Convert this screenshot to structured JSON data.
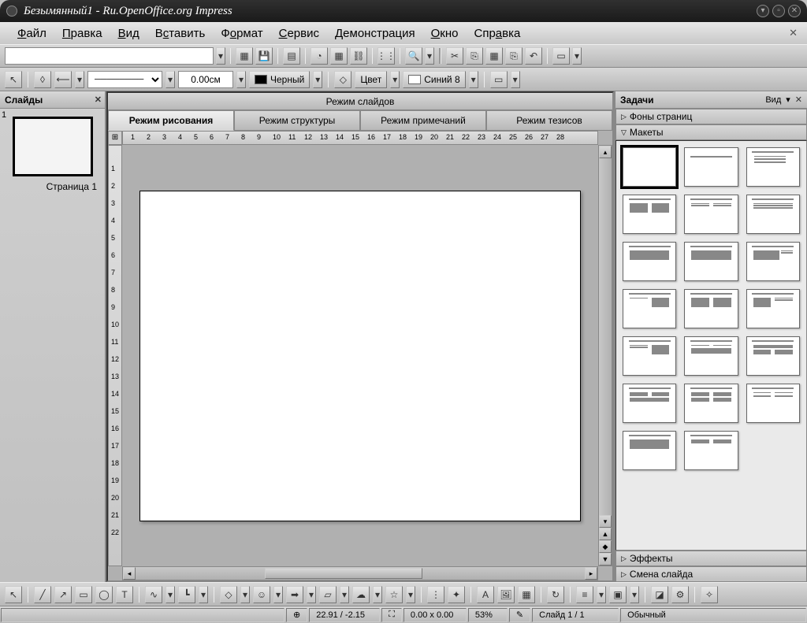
{
  "titlebar": {
    "text": "Безымянный1 - Ru.OpenOffice.org Impress"
  },
  "menu": {
    "file": "Файл",
    "edit": "Правка",
    "view": "Вид",
    "insert": "Вставить",
    "format": "Формат",
    "service": "Сервис",
    "demo": "Демонстрация",
    "window": "Окно",
    "help": "Справка"
  },
  "toolbar": {
    "url_value": "",
    "line_width": "0.00см",
    "color_black": "Черный",
    "fill_label": "Цвет",
    "fill_color": "Синий 8"
  },
  "slides_panel": {
    "title": "Слайды",
    "slide1_num": "1",
    "slide1_label": "Страница 1"
  },
  "center": {
    "header": "Режим слайдов",
    "tabs": {
      "draw": "Режим рисования",
      "outline": "Режим структуры",
      "notes": "Режим примечаний",
      "handout": "Режим тезисов"
    },
    "ruler_h": [
      "1",
      "2",
      "3",
      "4",
      "5",
      "6",
      "7",
      "8",
      "9",
      "10",
      "11",
      "12",
      "13",
      "14",
      "15",
      "16",
      "17",
      "18",
      "19",
      "20",
      "21",
      "22",
      "23",
      "24",
      "25",
      "26",
      "27",
      "28"
    ],
    "ruler_v": [
      "1",
      "2",
      "3",
      "4",
      "5",
      "6",
      "7",
      "8",
      "9",
      "10",
      "11",
      "12",
      "13",
      "14",
      "15",
      "16",
      "17",
      "18",
      "19",
      "20",
      "21",
      "22"
    ]
  },
  "tasks": {
    "title": "Задачи",
    "view_label": "Вид",
    "sections": {
      "backgrounds": "Фоны страниц",
      "layouts": "Макеты",
      "effects": "Эффекты",
      "transition": "Смена слайда"
    }
  },
  "status": {
    "pos": "22.91 / -2.15",
    "size": "0.00 x 0.00",
    "zoom": "53%",
    "slide": "Слайд 1 / 1",
    "mode": "Обычный"
  }
}
